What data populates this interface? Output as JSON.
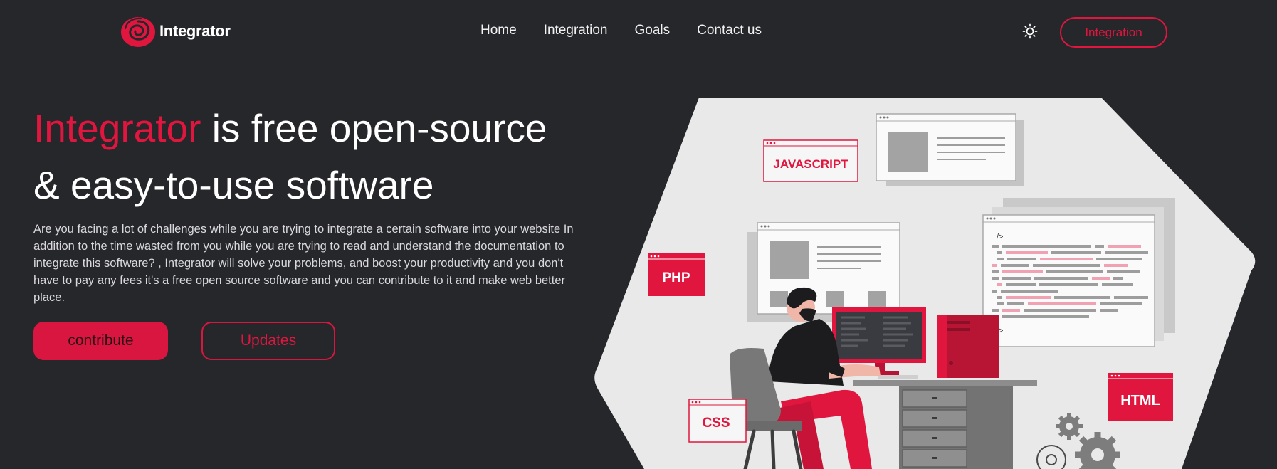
{
  "nav": {
    "logo_text": "Integrator",
    "links": [
      "Home",
      "Integration",
      "Goals",
      "Contact us"
    ],
    "theme_toggle_icon": "sun-icon",
    "cta_label": "Integration"
  },
  "hero": {
    "title_accent": "Integrator",
    "title_line1_rest": " is free open-source",
    "title_line2": "& easy-to-use software",
    "description": "Are you facing a lot of challenges while you are trying to integrate a certain software into your website In addition to the time wasted from you while you are trying to read and understand the documentation to integrate this software? , Integrator will solve your problems, and boost your productivity and you don't have to pay any fees it's a free open source software and you can contribute to it and make web better place.",
    "primary_button": "contribute",
    "secondary_button": "Updates"
  },
  "illustration": {
    "tags": {
      "javascript": "JAVASCRIPT",
      "php": "PHP",
      "css": "CSS",
      "html": "HTML",
      "code_open": "/>",
      "code_close": "/>"
    }
  },
  "colors": {
    "background": "#26272b",
    "accent": "#e0163f",
    "text": "#ffffff",
    "illustration_bg": "#e8e8e8"
  }
}
